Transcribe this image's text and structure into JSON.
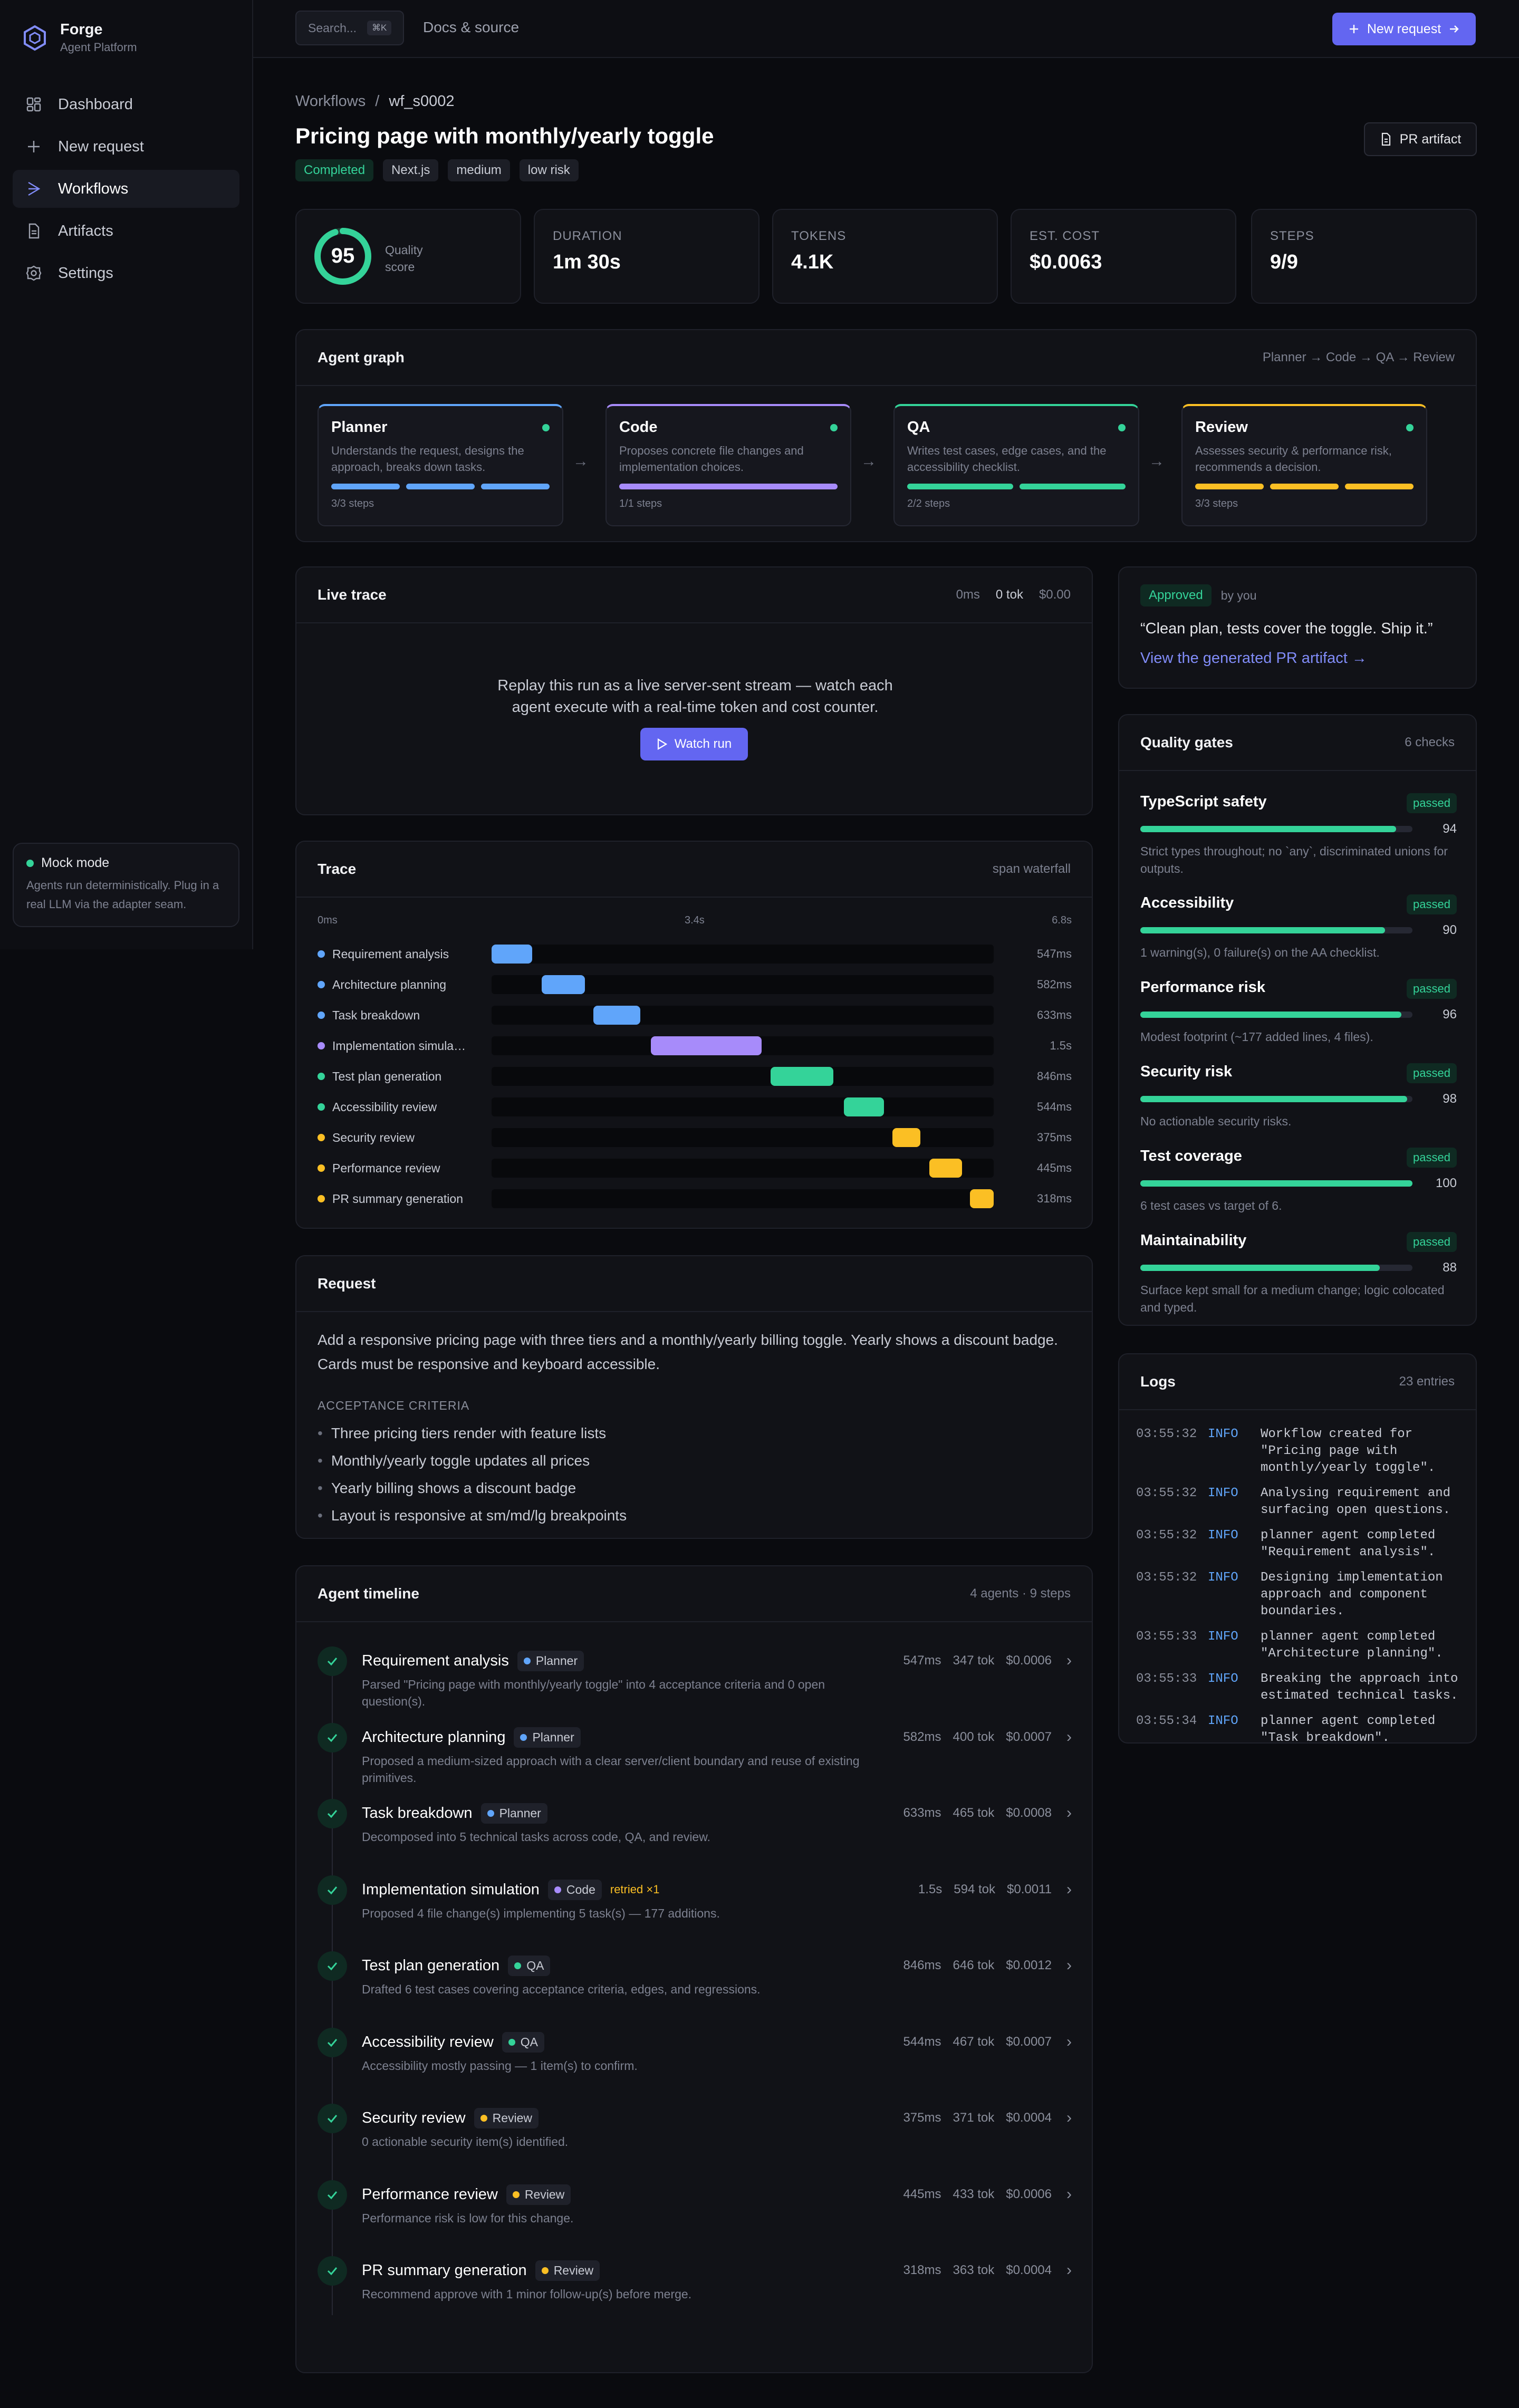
{
  "app": {
    "name": "Forge",
    "subtitle": "Agent Platform"
  },
  "nav": [
    {
      "label": "Dashboard",
      "icon": "grid-icon"
    },
    {
      "label": "New request",
      "icon": "plus-icon"
    },
    {
      "label": "Workflows",
      "icon": "workflow-icon",
      "active": true
    },
    {
      "label": "Artifacts",
      "icon": "document-icon"
    },
    {
      "label": "Settings",
      "icon": "gear-icon"
    }
  ],
  "mock": {
    "title": "Mock mode",
    "text": "Agents run deterministically. Plug in a real LLM via the adapter seam."
  },
  "topbar": {
    "search_placeholder": "Search...",
    "search_shortcut": "⌘K",
    "docs_label": "Docs & source",
    "new_request_label": "New request"
  },
  "breadcrumb": {
    "parent": "Workflows",
    "separator": "/",
    "current": "wf_s0002"
  },
  "page": {
    "title": "Pricing page with monthly/yearly toggle",
    "pr_button": "PR artifact"
  },
  "tags": [
    "Completed",
    "Next.js",
    "medium",
    "low risk"
  ],
  "stats": {
    "quality": {
      "score": "95",
      "label1": "Quality",
      "label2": "score",
      "fraction": 0.95
    },
    "duration": {
      "label": "DURATION",
      "value": "1m 30s"
    },
    "tokens": {
      "label": "TOKENS",
      "value": "4.1K"
    },
    "cost": {
      "label": "EST. COST",
      "value": "$0.0063"
    },
    "steps": {
      "label": "STEPS",
      "value": "9/9"
    }
  },
  "agent_graph": {
    "title": "Agent graph",
    "flow": "Planner → Code → QA → Review",
    "agents": [
      {
        "name": "Planner",
        "desc": "Understands the request, designs the approach, breaks down tasks.",
        "steps": "3/3 steps",
        "color": "#60a5fa",
        "bars": 3
      },
      {
        "name": "Code",
        "desc": "Proposes concrete file changes and implementation choices.",
        "steps": "1/1 steps",
        "color": "#a78bfa",
        "bars": 1
      },
      {
        "name": "QA",
        "desc": "Writes test cases, edge cases, and the accessibility checklist.",
        "steps": "2/2 steps",
        "color": "#34d399",
        "bars": 2
      },
      {
        "name": "Review",
        "desc": "Assesses security & performance risk, recommends a decision.",
        "steps": "3/3 steps",
        "color": "#fbbf24",
        "bars": 3
      }
    ]
  },
  "live_trace": {
    "title": "Live trace",
    "ms": "0ms",
    "tok": "0 tok",
    "cost": "$0.00",
    "text": "Replay this run as a live server-sent stream — watch each agent execute with a real-time token and cost counter.",
    "button": "Watch run"
  },
  "approval": {
    "badge": "Approved",
    "by": "by you",
    "quote": "“Clean plan, tests cover the toggle. Ship it.”",
    "link": "View the generated PR artifact →"
  },
  "trace": {
    "title": "Trace",
    "meta": "span waterfall",
    "axis": [
      "0ms",
      "3.4s",
      "6.8s"
    ],
    "total_ms": 6800,
    "spans": [
      {
        "name": "Requirement analysis",
        "start": 0,
        "dur": 547,
        "label": "547ms",
        "color": "#60a5fa"
      },
      {
        "name": "Architecture planning",
        "start": 680,
        "dur": 582,
        "label": "582ms",
        "color": "#60a5fa"
      },
      {
        "name": "Task breakdown",
        "start": 1380,
        "dur": 633,
        "label": "633ms",
        "color": "#60a5fa"
      },
      {
        "name": "Implementation simula…",
        "start": 2160,
        "dur": 1500,
        "label": "1.5s",
        "color": "#a78bfa"
      },
      {
        "name": "Test plan generation",
        "start": 3780,
        "dur": 846,
        "label": "846ms",
        "color": "#34d399"
      },
      {
        "name": "Accessibility review",
        "start": 4770,
        "dur": 544,
        "label": "544ms",
        "color": "#34d399"
      },
      {
        "name": "Security review",
        "start": 5430,
        "dur": 375,
        "label": "375ms",
        "color": "#fbbf24"
      },
      {
        "name": "Performance review",
        "start": 5930,
        "dur": 445,
        "label": "445ms",
        "color": "#fbbf24"
      },
      {
        "name": "PR summary generation",
        "start": 6490,
        "dur": 318,
        "label": "318ms",
        "color": "#fbbf24"
      }
    ]
  },
  "request": {
    "title": "Request",
    "text": "Add a responsive pricing page with three tiers and a monthly/yearly billing toggle. Yearly shows a discount badge. Cards must be responsive and keyboard accessible.",
    "criteria_label": "ACCEPTANCE CRITERIA",
    "criteria": [
      "Three pricing tiers render with feature lists",
      "Monthly/yearly toggle updates all prices",
      "Yearly billing shows a discount badge",
      "Layout is responsive at sm/md/lg breakpoints"
    ]
  },
  "timeline": {
    "title": "Agent timeline",
    "meta": "4 agents · 9 steps",
    "items": [
      {
        "name": "Requirement analysis",
        "agent": "Planner",
        "color": "#60a5fa",
        "desc": "Parsed \"Pricing page with monthly/yearly toggle\" into 4 acceptance criteria and 0 open question(s).",
        "ms": "547ms",
        "tok": "347 tok",
        "cost": "$0.0006"
      },
      {
        "name": "Architecture planning",
        "agent": "Planner",
        "color": "#60a5fa",
        "desc": "Proposed a medium-sized approach with a clear server/client boundary and reuse of existing primitives.",
        "ms": "582ms",
        "tok": "400 tok",
        "cost": "$0.0007"
      },
      {
        "name": "Task breakdown",
        "agent": "Planner",
        "color": "#60a5fa",
        "desc": "Decomposed into 5 technical tasks across code, QA, and review.",
        "ms": "633ms",
        "tok": "465 tok",
        "cost": "$0.0008"
      },
      {
        "name": "Implementation simulation",
        "agent": "Code",
        "color": "#a78bfa",
        "retry": "retried ×1",
        "desc": "Proposed 4 file change(s) implementing 5 task(s) — 177 additions.",
        "ms": "1.5s",
        "tok": "594 tok",
        "cost": "$0.0011"
      },
      {
        "name": "Test plan generation",
        "agent": "QA",
        "color": "#34d399",
        "desc": "Drafted 6 test cases covering acceptance criteria, edges, and regressions.",
        "ms": "846ms",
        "tok": "646 tok",
        "cost": "$0.0012"
      },
      {
        "name": "Accessibility review",
        "agent": "QA",
        "color": "#34d399",
        "desc": "Accessibility mostly passing — 1 item(s) to confirm.",
        "ms": "544ms",
        "tok": "467 tok",
        "cost": "$0.0007"
      },
      {
        "name": "Security review",
        "agent": "Review",
        "color": "#fbbf24",
        "desc": "0 actionable security item(s) identified.",
        "ms": "375ms",
        "tok": "371 tok",
        "cost": "$0.0004"
      },
      {
        "name": "Performance review",
        "agent": "Review",
        "color": "#fbbf24",
        "desc": "Performance risk is low for this change.",
        "ms": "445ms",
        "tok": "433 tok",
        "cost": "$0.0006"
      },
      {
        "name": "PR summary generation",
        "agent": "Review",
        "color": "#fbbf24",
        "desc": "Recommend approve with 1 minor follow-up(s) before merge.",
        "ms": "318ms",
        "tok": "363 tok",
        "cost": "$0.0004"
      }
    ]
  },
  "gates": {
    "title": "Quality gates",
    "meta": "6 checks",
    "items": [
      {
        "name": "TypeScript safety",
        "status": "passed",
        "score": 94,
        "desc": "Strict types throughout; no `any`, discriminated unions for outputs."
      },
      {
        "name": "Accessibility",
        "status": "passed",
        "score": 90,
        "desc": "1 warning(s), 0 failure(s) on the AA checklist."
      },
      {
        "name": "Performance risk",
        "status": "passed",
        "score": 96,
        "desc": "Modest footprint (~177 added lines, 4 files)."
      },
      {
        "name": "Security risk",
        "status": "passed",
        "score": 98,
        "desc": "No actionable security risks."
      },
      {
        "name": "Test coverage",
        "status": "passed",
        "score": 100,
        "desc": "6 test cases vs target of 6."
      },
      {
        "name": "Maintainability",
        "status": "passed",
        "score": 88,
        "desc": "Surface kept small for a medium change; logic colocated and typed."
      }
    ]
  },
  "logs": {
    "title": "Logs",
    "meta": "23 entries",
    "entries": [
      {
        "time": "03:55:32",
        "level": "INFO",
        "msg": "Workflow created for\n\"Pricing page with\nmonthly/yearly toggle\"."
      },
      {
        "time": "03:55:32",
        "level": "INFO",
        "msg": "Analysing requirement and\nsurfacing open questions."
      },
      {
        "time": "03:55:32",
        "level": "INFO",
        "msg": "planner agent completed\n\"Requirement analysis\"."
      },
      {
        "time": "03:55:32",
        "level": "INFO",
        "msg": "Designing implementation\napproach and component\nboundaries."
      },
      {
        "time": "03:55:33",
        "level": "INFO",
        "msg": "planner agent completed\n\"Architecture planning\"."
      },
      {
        "time": "03:55:33",
        "level": "INFO",
        "msg": "Breaking the approach into\nestimated technical tasks."
      },
      {
        "time": "03:55:34",
        "level": "INFO",
        "msg": "planner agent completed\n\"Task breakdown\"."
      }
    ]
  }
}
